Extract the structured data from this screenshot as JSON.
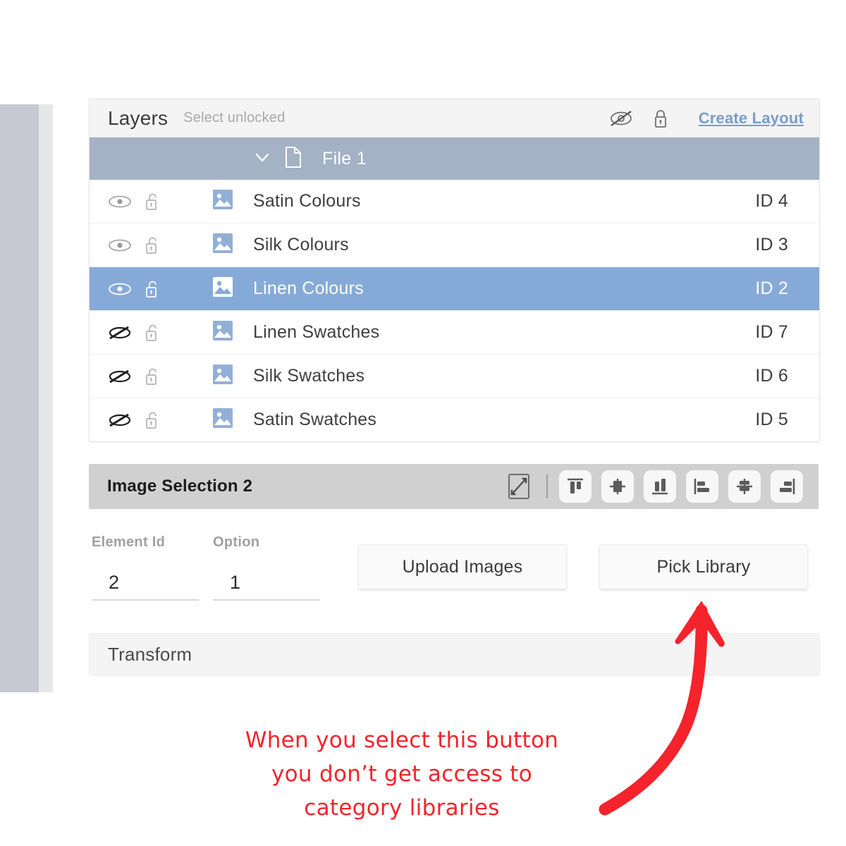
{
  "colors": {
    "accent_blue": "#86aad8",
    "file_row": "#a3b2c4",
    "link_blue": "#7a9cc8",
    "annotation_red": "#f5232b",
    "toolbar_gray": "#d0d0d0",
    "left_strip": "#c6c8d2"
  },
  "layers_panel": {
    "title": "Layers",
    "subtitle": "Select unlocked",
    "header_icons": [
      "eye-slash-icon",
      "lock-closed-icon"
    ],
    "create_layout_label": "Create Layout",
    "file_group": {
      "chevron": "chevron-down-icon",
      "file_icon": "file-icon",
      "name": "File 1"
    },
    "rows": [
      {
        "name": "Satin Colours",
        "id": "ID 4",
        "visible": true,
        "locked": false,
        "selected": false,
        "vis_icon": "eye-icon",
        "lock_icon": "lock-open-icon",
        "thumb_icon": "image-icon"
      },
      {
        "name": "Silk Colours",
        "id": "ID 3",
        "visible": true,
        "locked": false,
        "selected": false,
        "vis_icon": "eye-icon",
        "lock_icon": "lock-open-icon",
        "thumb_icon": "image-icon"
      },
      {
        "name": "Linen Colours",
        "id": "ID 2",
        "visible": true,
        "locked": false,
        "selected": true,
        "vis_icon": "eye-icon",
        "lock_icon": "lock-open-icon",
        "thumb_icon": "image-icon"
      },
      {
        "name": "Linen Swatches",
        "id": "ID 7",
        "visible": false,
        "locked": false,
        "selected": false,
        "vis_icon": "eye-slash-icon",
        "lock_icon": "lock-open-icon",
        "thumb_icon": "image-icon"
      },
      {
        "name": "Silk Swatches",
        "id": "ID 6",
        "visible": false,
        "locked": false,
        "selected": false,
        "vis_icon": "eye-slash-icon",
        "lock_icon": "lock-open-icon",
        "thumb_icon": "image-icon"
      },
      {
        "name": "Satin Swatches",
        "id": "ID 5",
        "visible": false,
        "locked": false,
        "selected": false,
        "vis_icon": "eye-slash-icon",
        "lock_icon": "lock-open-icon",
        "thumb_icon": "image-icon"
      }
    ]
  },
  "selection_bar": {
    "title": "Image Selection 2",
    "tools": [
      {
        "name": "fit-to-frame-icon",
        "label": "Fit to frame"
      },
      {
        "name": "toolbar-divider",
        "label": ""
      },
      {
        "name": "align-top-icon",
        "label": "Align top"
      },
      {
        "name": "align-center-horizontal-icon",
        "label": "Align center horizontally"
      },
      {
        "name": "align-bottom-icon",
        "label": "Align bottom"
      },
      {
        "name": "align-left-icon",
        "label": "Align left"
      },
      {
        "name": "align-center-vertical-icon",
        "label": "Align center vertically"
      },
      {
        "name": "align-right-icon",
        "label": "Align right"
      }
    ]
  },
  "form": {
    "element_id": {
      "label": "Element Id",
      "value": "2"
    },
    "option": {
      "label": "Option",
      "value": "1"
    },
    "upload_button": "Upload Images",
    "pick_library_button": "Pick Library"
  },
  "transform": {
    "title": "Transform"
  },
  "annotation": {
    "line1": "When you select this button",
    "line2": "you don’t get access to",
    "line3": "category libraries",
    "arrow": "curved-arrow-up-icon"
  }
}
